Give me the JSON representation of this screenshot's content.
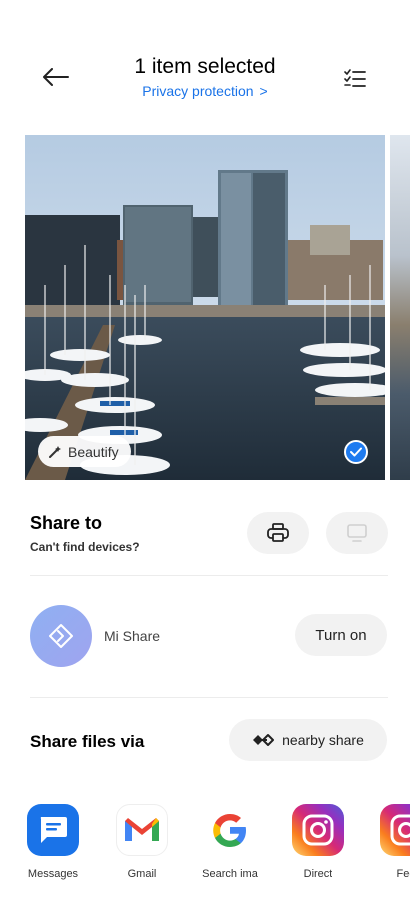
{
  "header": {
    "title": "1 item selected",
    "subtitle": "Privacy protection",
    "subtitle_chevron": ">"
  },
  "photo": {
    "beautify_label": "Beautify",
    "selected": true
  },
  "share_to": {
    "title": "Share to",
    "subtitle": "Can't find devices?",
    "print_icon": "printer-icon",
    "screen_icon": "monitor-icon"
  },
  "mi_share": {
    "label": "Mi Share",
    "turn_on_label": "Turn on"
  },
  "share_files": {
    "title": "Share files via",
    "nearby_label": "nearby share"
  },
  "apps": [
    {
      "label": "Messages",
      "icon": "messages-icon"
    },
    {
      "label": "Gmail",
      "icon": "gmail-icon"
    },
    {
      "label": "Search ima",
      "icon": "google-icon"
    },
    {
      "label": "Direct",
      "icon": "instagram-icon"
    },
    {
      "label": "Fee",
      "icon": "instagram-icon"
    }
  ],
  "colors": {
    "accent": "#1a73e8",
    "check": "#1e7bf0",
    "pill_bg": "#f2f2f2"
  }
}
